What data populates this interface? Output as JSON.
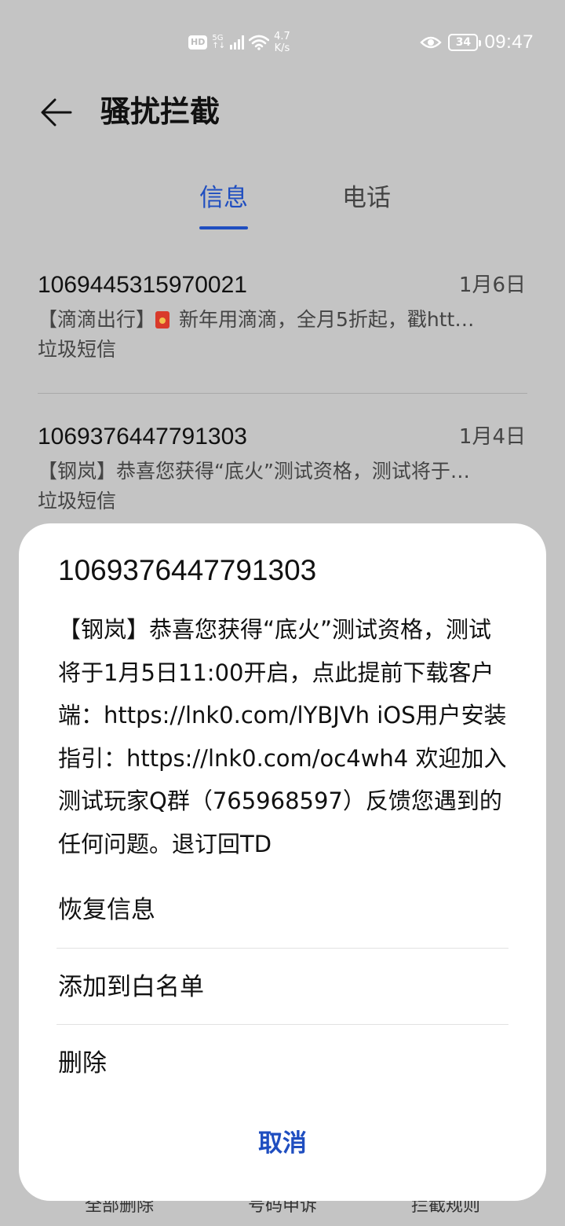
{
  "status_bar": {
    "hd_label": "HD",
    "network_type": "5G",
    "network_sub": "↑↓",
    "net_speed_value": "4.7",
    "net_speed_unit": "K/s",
    "battery_level": "34",
    "time": "09:47",
    "icons": [
      "hd-icon",
      "signal-icon",
      "wifi-icon",
      "eye-icon",
      "battery-icon"
    ]
  },
  "header": {
    "title": "骚扰拦截",
    "back_icon": "arrow-left-icon"
  },
  "tabs": [
    {
      "label": "信息",
      "active": true
    },
    {
      "label": "电话",
      "active": false
    }
  ],
  "messages": [
    {
      "sender": "1069445315970021",
      "date": "1月6日",
      "preview_prefix": "【滴滴出行】",
      "preview": " 新年用滴滴，全月5折起，戳htt…",
      "tag": "垃圾短信"
    },
    {
      "sender": "1069376447791303",
      "date": "1月4日",
      "preview": "【钢岚】恭喜您获得“底火”测试资格，测试将于…",
      "tag": "垃圾短信"
    }
  ],
  "bottom_toolbar": {
    "items": [
      "全部删除",
      "号码申诉",
      "拦截规则"
    ]
  },
  "sheet": {
    "number": "1069376447791303",
    "body": "【钢岚】恭喜您获得“底火”测试资格，测试将于1月5日11:00开启，点此提前下载客户端：https://lnk0.com/lYBJVh iOS用户安装指引：https://lnk0.com/oc4wh4 欢迎加入测试玩家Q群（765968597）反馈您遇到的任何问题。退订回TD",
    "actions": [
      "恢复信息",
      "添加到白名单",
      "删除"
    ],
    "cancel_label": "取消"
  },
  "colors": {
    "accent": "#1f4ec0",
    "dim_background": "#c4c4c4",
    "sheet_background": "#ffffff"
  }
}
